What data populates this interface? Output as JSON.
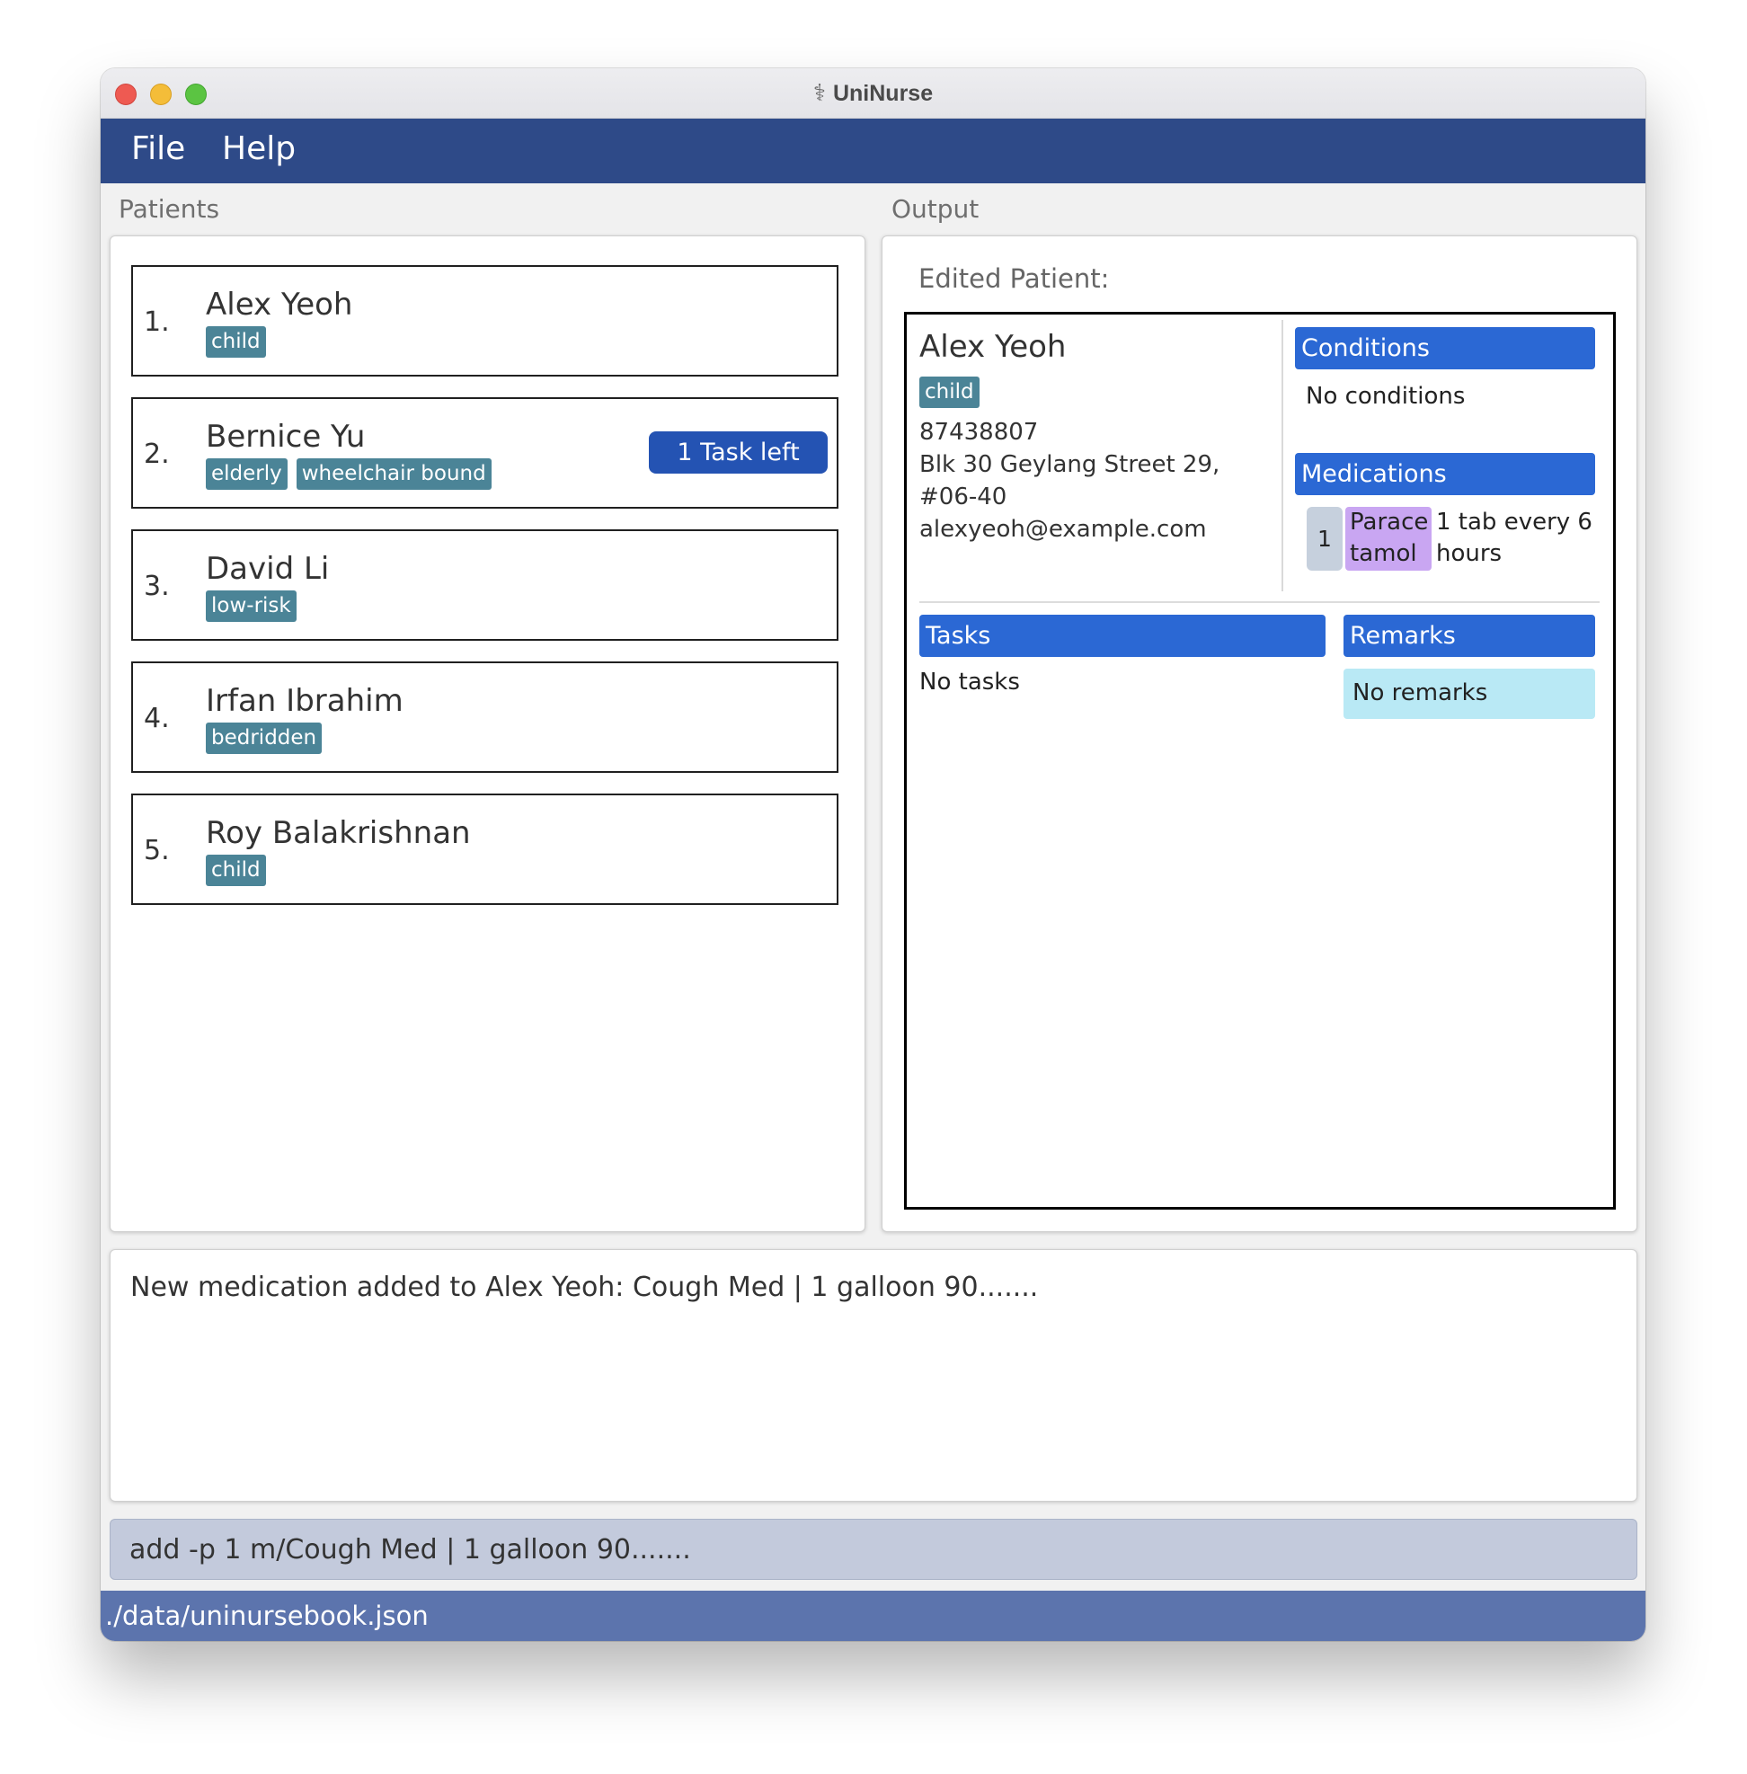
{
  "window": {
    "title": "UniNurse",
    "app_icon": "caduceus-icon"
  },
  "menu": {
    "file": "File",
    "help": "Help"
  },
  "labels": {
    "patients": "Patients",
    "output": "Output"
  },
  "patients": [
    {
      "index": "1.",
      "name": "Alex Yeoh",
      "tags": [
        "child"
      ],
      "tasks_left": ""
    },
    {
      "index": "2.",
      "name": "Bernice Yu",
      "tags": [
        "elderly",
        "wheelchair bound"
      ],
      "tasks_left": "1 Task left"
    },
    {
      "index": "3.",
      "name": "David Li",
      "tags": [
        "low-risk"
      ],
      "tasks_left": ""
    },
    {
      "index": "4.",
      "name": "Irfan Ibrahim",
      "tags": [
        "bedridden"
      ],
      "tasks_left": ""
    },
    {
      "index": "5.",
      "name": "Roy Balakrishnan",
      "tags": [
        "child"
      ],
      "tasks_left": ""
    }
  ],
  "output": {
    "header": "Edited Patient:",
    "patient": {
      "name": "Alex Yeoh",
      "tag": "child",
      "phone": "87438807",
      "address_line1": "Blk 30 Geylang Street 29,",
      "address_line2": "#06-40",
      "email": "alexyeoh@example.com"
    },
    "conditions": {
      "header": "Conditions",
      "text": "No conditions"
    },
    "medications": {
      "header": "Medications",
      "items": [
        {
          "index": "1",
          "name_line1": "Parace",
          "name_line2": "tamol",
          "dose_line1": "1 tab every 6",
          "dose_line2": "hours"
        }
      ]
    },
    "tasks": {
      "header": "Tasks",
      "text": "No tasks"
    },
    "remarks": {
      "header": "Remarks",
      "text": "No remarks"
    }
  },
  "result": {
    "text": "New medication added to Alex Yeoh: Cough Med | 1 galloon 90......."
  },
  "command": {
    "value": "add -p 1 m/Cough Med | 1 galloon 90......."
  },
  "status": {
    "path": "./data/uninursebook.json"
  },
  "colors": {
    "menubar": "#2e4a88",
    "tag": "#4b8497",
    "task_badge": "#2453b3",
    "section_header": "#2b68d4",
    "medication_name": "#c9a6f2",
    "remarks_bg": "#b9e9f5",
    "command_bg": "#c3cadc",
    "status_bar": "#5c74ad"
  }
}
